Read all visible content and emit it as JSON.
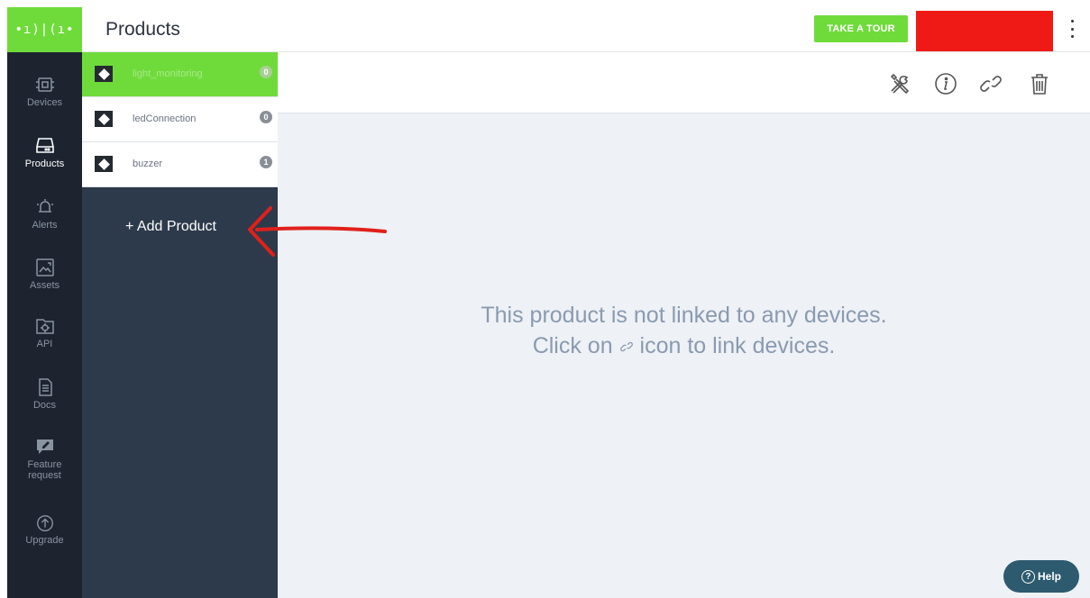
{
  "header": {
    "logo_text": "•ı)|(ı•",
    "title": "Products",
    "tour_label": "TAKE A TOUR",
    "brand_color": "#6fdb3b",
    "redaction_color": "#ef1a16"
  },
  "rail": {
    "items": [
      {
        "label": "Devices",
        "icon": "chip-icon"
      },
      {
        "label": "Products",
        "icon": "drive-icon",
        "active": true
      },
      {
        "label": "Alerts",
        "icon": "bell-icon"
      },
      {
        "label": "Assets",
        "icon": "image-icon"
      },
      {
        "label": "API",
        "icon": "folder-gear-icon"
      },
      {
        "label": "Docs",
        "icon": "document-icon"
      },
      {
        "label": "Feature",
        "label2": "request",
        "icon": "comment-edit-icon"
      },
      {
        "label": "Upgrade",
        "icon": "arrow-up-circle-icon"
      }
    ]
  },
  "products": [
    {
      "name": "light_monitoring",
      "count": "0",
      "active": true
    },
    {
      "name": "ledConnection",
      "count": "0"
    },
    {
      "name": "buzzer",
      "count": "1"
    }
  ],
  "add_product_label": "+ Add Product",
  "toolbar": {
    "icons": [
      "tools-icon",
      "info-icon",
      "link-icon",
      "trash-icon"
    ]
  },
  "main": {
    "message_line1": "This product is not linked to any devices.",
    "message_line2_before": "Click on ",
    "message_line2_after": " icon to link devices."
  },
  "help": {
    "label": "Help"
  },
  "annotation_color": "#e0201a"
}
